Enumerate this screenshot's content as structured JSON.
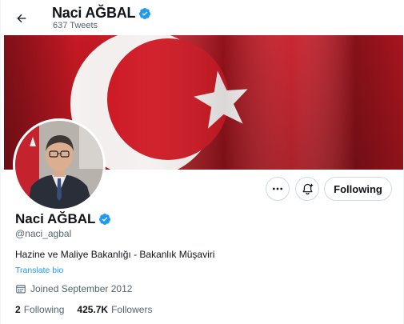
{
  "header": {
    "name": "Naci AĞBAL",
    "tweet_count": "637 Tweets"
  },
  "profile": {
    "name": "Naci AĞBAL",
    "handle": "@naci_agbal",
    "bio": "Hazine ve Maliye Bakanlığı - Bakanlık Müşaviri",
    "translate_label": "Translate bio",
    "joined": "Joined September 2012",
    "following_count": "2",
    "following_label": "Following",
    "followers_count": "425.7K",
    "followers_label": "Followers"
  },
  "actions": {
    "follow_label": "Following"
  },
  "colors": {
    "accent": "#1d9bf0",
    "banner_red": "#d11a26",
    "verified": "#1d9bf0"
  },
  "icons": [
    "back-arrow-icon",
    "verified-badge-icon",
    "more-icon",
    "notification-bell-icon",
    "calendar-icon"
  ]
}
